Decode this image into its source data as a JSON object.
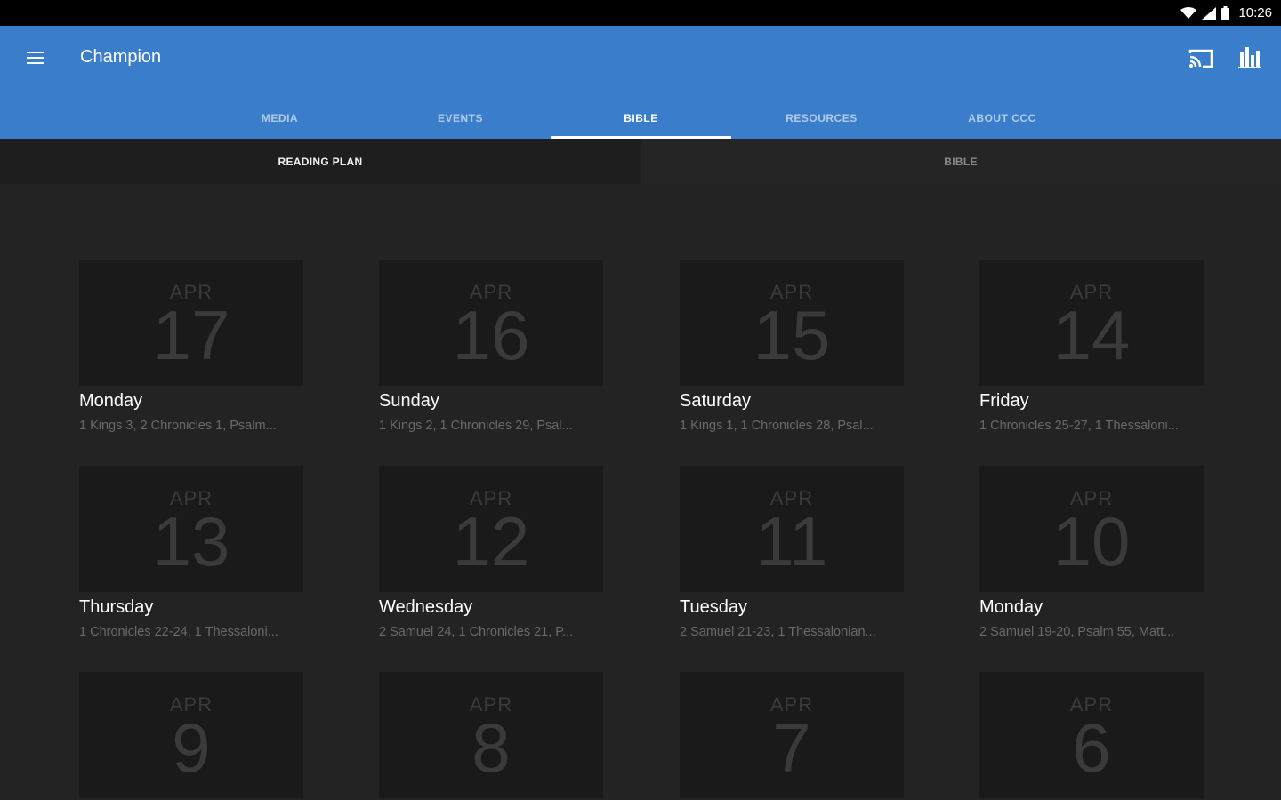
{
  "status_bar": {
    "time": "10:26"
  },
  "app": {
    "title": "Champion"
  },
  "tabs": [
    {
      "label": "MEDIA"
    },
    {
      "label": "EVENTS"
    },
    {
      "label": "BIBLE"
    },
    {
      "label": "RESOURCES"
    },
    {
      "label": "ABOUT CCC"
    }
  ],
  "subtabs": [
    {
      "label": "READING PLAN"
    },
    {
      "label": "BIBLE"
    }
  ],
  "cards": [
    {
      "month": "APR",
      "day": "17",
      "weekday": "Monday",
      "readings": "1 Kings 3, 2 Chronicles 1, Psalm..."
    },
    {
      "month": "APR",
      "day": "16",
      "weekday": "Sunday",
      "readings": "1 Kings 2, 1 Chronicles 29, Psal..."
    },
    {
      "month": "APR",
      "day": "15",
      "weekday": "Saturday",
      "readings": "1 Kings 1, 1 Chronicles 28, Psal..."
    },
    {
      "month": "APR",
      "day": "14",
      "weekday": "Friday",
      "readings": "1 Chronicles 25-27, 1 Thessaloni..."
    },
    {
      "month": "APR",
      "day": "13",
      "weekday": "Thursday",
      "readings": "1 Chronicles 22-24, 1 Thessaloni..."
    },
    {
      "month": "APR",
      "day": "12",
      "weekday": "Wednesday",
      "readings": "2 Samuel 24, 1 Chronicles 21, P..."
    },
    {
      "month": "APR",
      "day": "11",
      "weekday": "Tuesday",
      "readings": "2 Samuel 21-23, 1 Thessalonian..."
    },
    {
      "month": "APR",
      "day": "10",
      "weekday": "Monday",
      "readings": "2 Samuel 19-20, Psalm 55, Matt..."
    },
    {
      "month": "APR",
      "day": "9",
      "weekday": "",
      "readings": ""
    },
    {
      "month": "APR",
      "day": "8",
      "weekday": "",
      "readings": ""
    },
    {
      "month": "APR",
      "day": "7",
      "weekday": "",
      "readings": ""
    },
    {
      "month": "APR",
      "day": "6",
      "weekday": "",
      "readings": ""
    }
  ]
}
